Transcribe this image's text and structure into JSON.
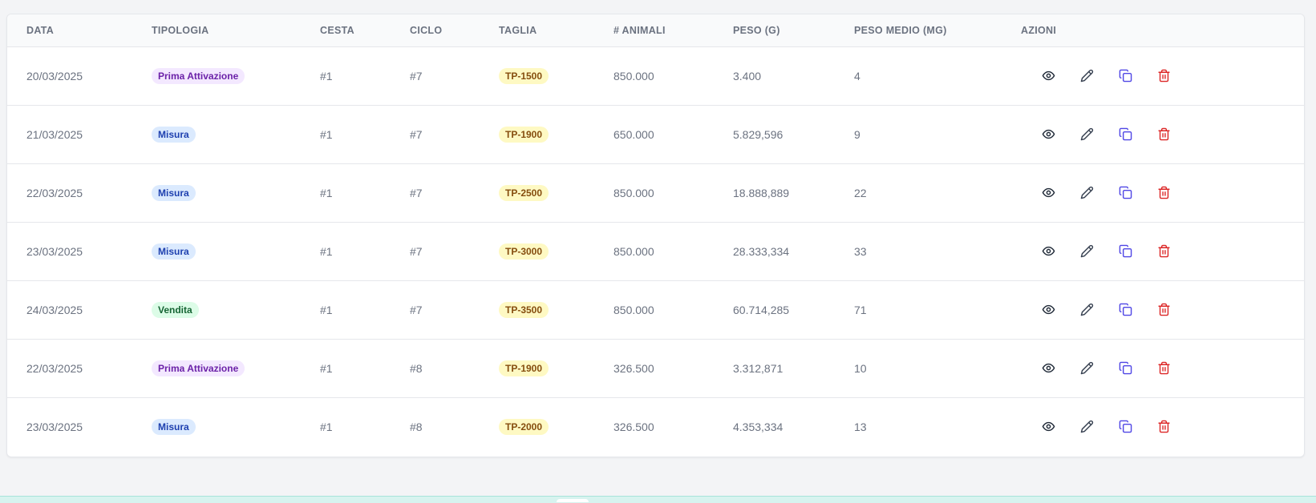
{
  "table": {
    "headers": [
      "Data",
      "Tipologia",
      "Cesta",
      "Ciclo",
      "Taglia",
      "# Animali",
      "Peso (g)",
      "Peso medio (mg)",
      "Azioni"
    ],
    "rows": [
      {
        "data": "20/03/2025",
        "tipologia": "Prima Attivazione",
        "tipo_color": "purple",
        "cesta": "#1",
        "ciclo": "#7",
        "taglia": "TP-1500",
        "animali": "850.000",
        "peso": "3.400",
        "peso_medio": "4"
      },
      {
        "data": "21/03/2025",
        "tipologia": "Misura",
        "tipo_color": "blue",
        "cesta": "#1",
        "ciclo": "#7",
        "taglia": "TP-1900",
        "animali": "650.000",
        "peso": "5.829,596",
        "peso_medio": "9"
      },
      {
        "data": "22/03/2025",
        "tipologia": "Misura",
        "tipo_color": "blue",
        "cesta": "#1",
        "ciclo": "#7",
        "taglia": "TP-2500",
        "animali": "850.000",
        "peso": "18.888,889",
        "peso_medio": "22"
      },
      {
        "data": "23/03/2025",
        "tipologia": "Misura",
        "tipo_color": "blue",
        "cesta": "#1",
        "ciclo": "#7",
        "taglia": "TP-3000",
        "animali": "850.000",
        "peso": "28.333,334",
        "peso_medio": "33"
      },
      {
        "data": "24/03/2025",
        "tipologia": "Vendita",
        "tipo_color": "green",
        "cesta": "#1",
        "ciclo": "#7",
        "taglia": "TP-3500",
        "animali": "850.000",
        "peso": "60.714,285",
        "peso_medio": "71"
      },
      {
        "data": "22/03/2025",
        "tipologia": "Prima Attivazione",
        "tipo_color": "purple",
        "cesta": "#1",
        "ciclo": "#8",
        "taglia": "TP-1900",
        "animali": "326.500",
        "peso": "3.312,871",
        "peso_medio": "10"
      },
      {
        "data": "23/03/2025",
        "tipologia": "Misura",
        "tipo_color": "blue",
        "cesta": "#1",
        "ciclo": "#8",
        "taglia": "TP-2000",
        "animali": "326.500",
        "peso": "4.353,334",
        "peso_medio": "13"
      }
    ],
    "actions": [
      {
        "name": "view",
        "icon": "eye-icon",
        "color": "#1f2937"
      },
      {
        "name": "edit",
        "icon": "pencil-icon",
        "color": "#374151"
      },
      {
        "name": "duplicate",
        "icon": "copy-icon",
        "color": "#4f46e5"
      },
      {
        "name": "delete",
        "icon": "trash-icon",
        "color": "#dc2626"
      }
    ]
  },
  "colors": {
    "header_bg": "#f9fafb",
    "badge_purple": "#f3e8ff",
    "badge_blue": "#dbeafe",
    "badge_green": "#dcfce7",
    "badge_yellow": "#fef9c3",
    "delete_red": "#dc2626",
    "duplicate_indigo": "#4f46e5"
  }
}
